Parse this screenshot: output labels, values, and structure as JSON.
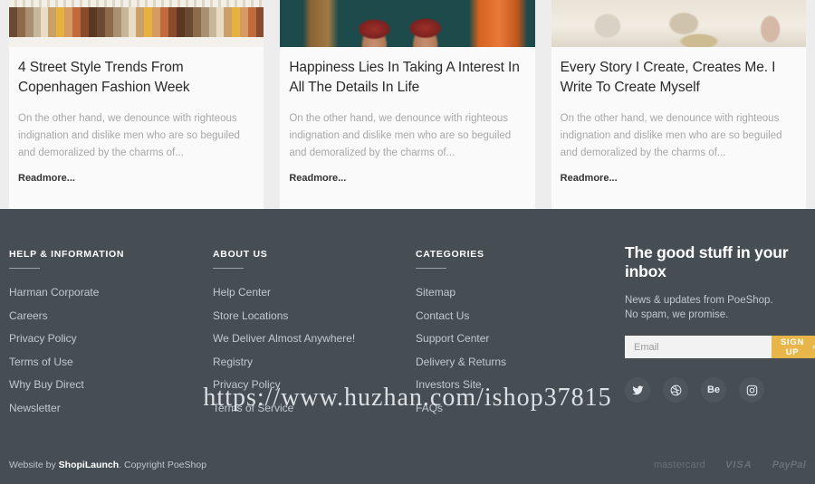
{
  "blog": {
    "posts": [
      {
        "image": "embroidery-threads-photo",
        "title": "4 Street Style Trends From Copenhagen Fashion Week",
        "excerpt": "On the other hand, we denounce with righteous indignation and dislike men who are so beguiled and demoralized by the charms of...",
        "readmore": "Readmore..."
      },
      {
        "image": "hands-holding-yarn-photo",
        "title": "Happiness Lies In Taking A Interest In All The Details In Life",
        "excerpt": "On the other hand, we denounce with righteous indignation and dislike men who are so beguiled and demoralized by the charms of...",
        "readmore": "Readmore..."
      },
      {
        "image": "ceramic-pots-photo",
        "title": "Every Story I Create, Creates Me. I Write To Create Myself",
        "excerpt": "On the other hand, we denounce with righteous indignation and dislike men who are so beguiled and demoralized by the charms of...",
        "readmore": "Readmore..."
      }
    ]
  },
  "footer": {
    "columns": [
      {
        "heading": "HELP & INFORMATION",
        "links": [
          "Harman Corporate",
          "Careers",
          "Privacy Policy",
          "Terms of Use",
          "Why Buy Direct",
          "Newsletter"
        ]
      },
      {
        "heading": "ABOUT US",
        "links": [
          "Help Center",
          "Store Locations",
          "We Deliver Almost Anywhere!",
          "Registry",
          "Privacy Policy",
          "Terms of Service"
        ]
      },
      {
        "heading": "CATEGORIES",
        "links": [
          "Sitemap",
          "Contact Us",
          "Support Center",
          "Delivery & Returns",
          "Investors Site",
          "FAQs"
        ]
      }
    ],
    "newsletter": {
      "title": "The good stuff in your inbox",
      "subtitle_line1": "News & updates from PoeShop.",
      "subtitle_line2": "No spam, we promise.",
      "email_placeholder": "Email",
      "email_value": "",
      "button_label": "SIGN UP",
      "button_chevron": "›",
      "button_color": "#e8b549"
    },
    "socials": [
      {
        "name": "twitter",
        "label": "Twitter"
      },
      {
        "name": "dribbble",
        "label": "Dribbble"
      },
      {
        "name": "behance",
        "label": "Behance"
      },
      {
        "name": "instagram",
        "label": "Instagram"
      }
    ],
    "bottom": {
      "credit_prefix": "Website by ",
      "credit_brand": "ShopiLaunch",
      "credit_suffix": ". Copyright PoeShop",
      "payments": [
        "mastercard",
        "VISA",
        "PayPal"
      ]
    },
    "background_color": "#464e54"
  },
  "watermark": {
    "text": "https://www.huzhan.com/ishop37815"
  }
}
